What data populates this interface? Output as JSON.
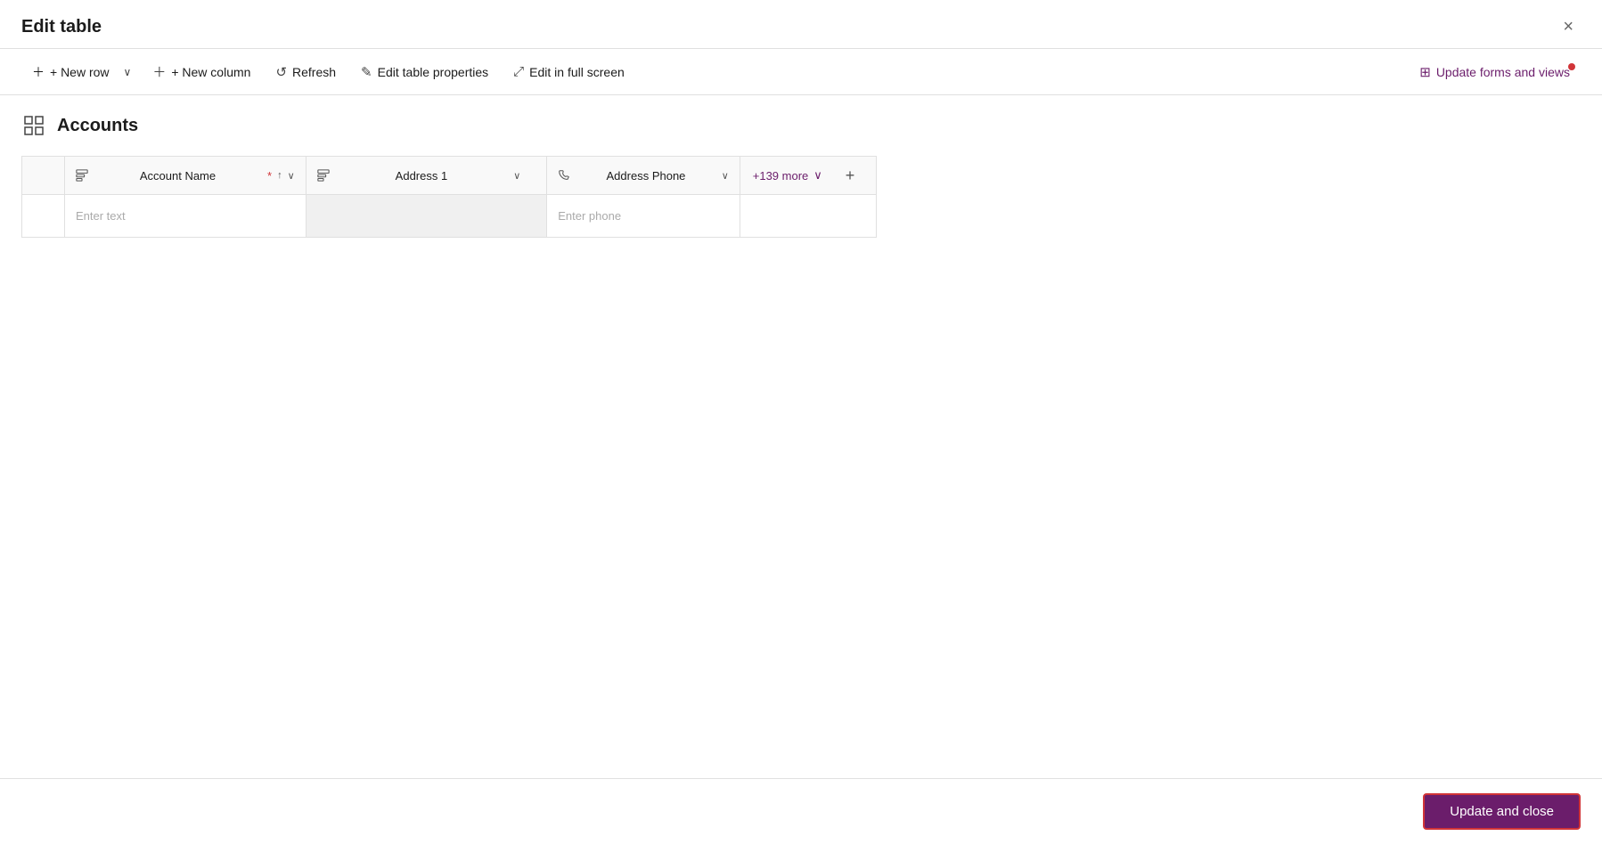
{
  "dialog": {
    "title": "Edit table",
    "close_label": "×"
  },
  "toolbar": {
    "new_row_label": "+ New row",
    "new_row_caret": "∨",
    "new_column_label": "+ New column",
    "refresh_label": "Refresh",
    "edit_table_props_label": "Edit table properties",
    "edit_fullscreen_label": "Edit in full screen",
    "update_forms_label": "Update forms and views"
  },
  "table": {
    "name": "Accounts",
    "columns": [
      {
        "id": "account_name",
        "label": "Account Name",
        "required": true,
        "sortable": true,
        "icon": "text-icon",
        "placeholder": "Enter text"
      },
      {
        "id": "address1",
        "label": "Address 1",
        "required": false,
        "sortable": false,
        "icon": "text-icon",
        "placeholder": "",
        "highlighted": true
      },
      {
        "id": "address_phone",
        "label": "Address Phone",
        "required": false,
        "sortable": false,
        "icon": "phone-icon",
        "placeholder": "Enter phone"
      }
    ],
    "more_columns_label": "+139 more",
    "add_column_label": "+"
  },
  "footer": {
    "update_close_label": "Update and close"
  }
}
